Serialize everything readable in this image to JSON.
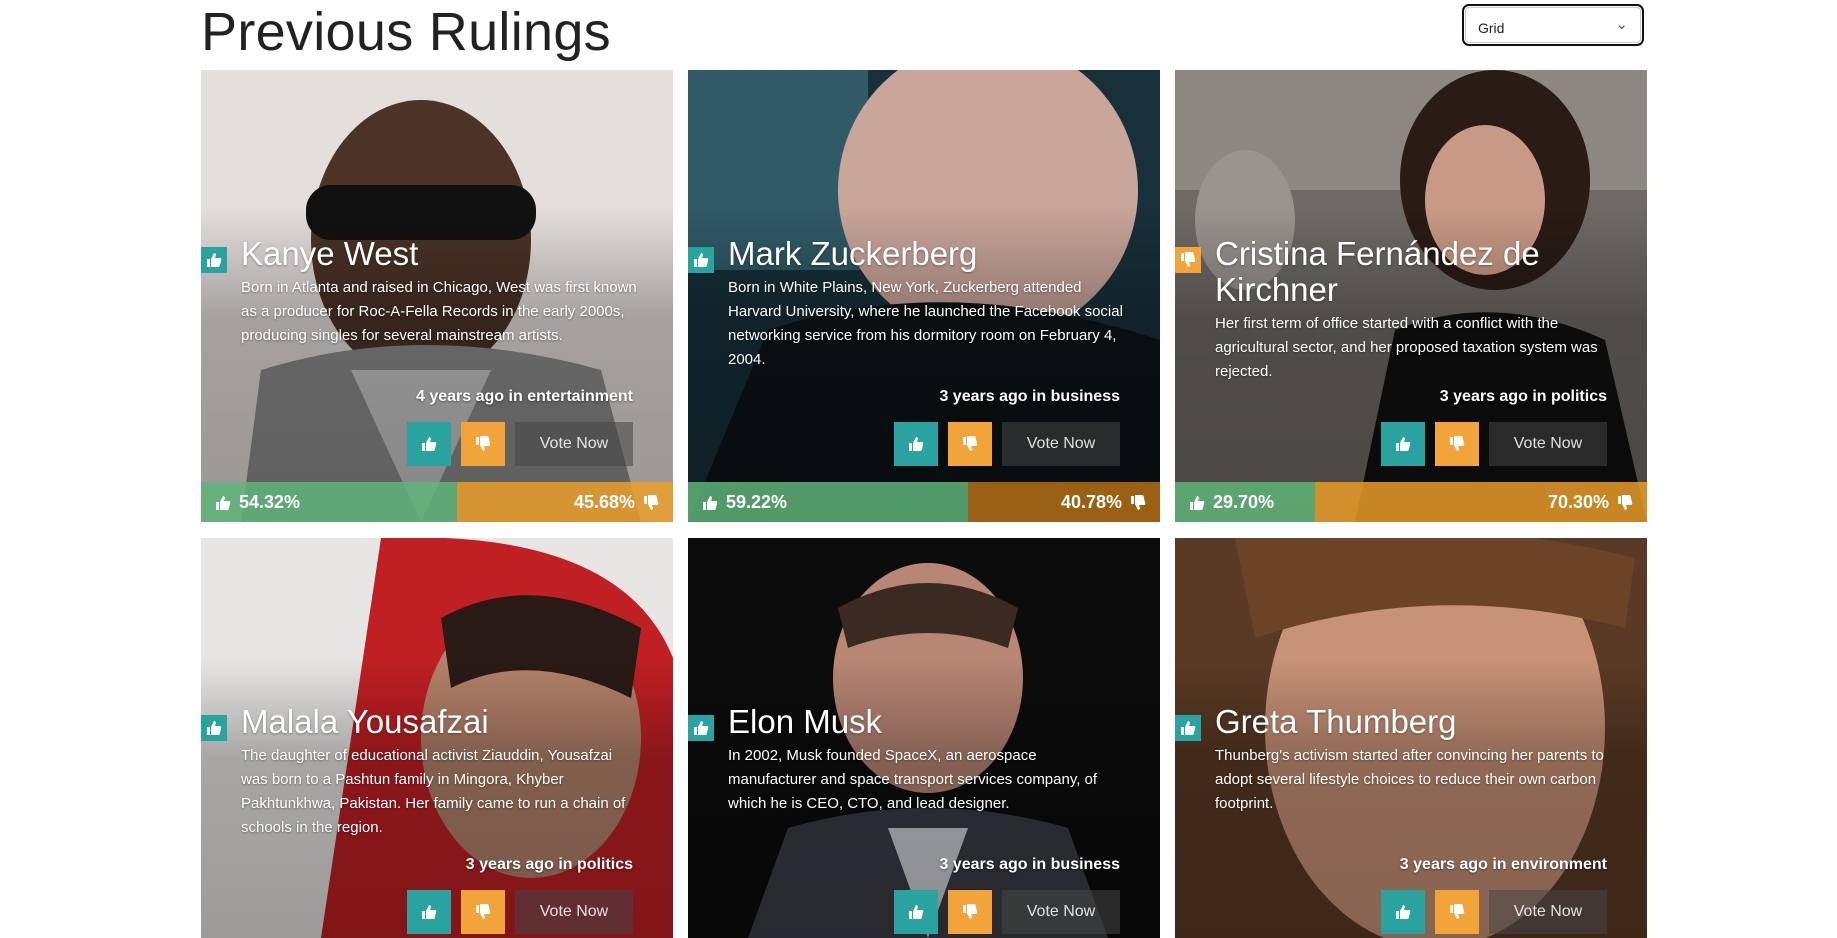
{
  "page": {
    "title": "Previous Rulings"
  },
  "view_select": {
    "value": "Grid",
    "icon": "chevron-down-icon"
  },
  "vote_label": "Vote Now",
  "colors": {
    "approve": "#2aa3a0",
    "reject": "#f2a43a",
    "approve_bar": "#5fb478",
    "reject_bar": "#f0a028"
  },
  "rulings": [
    {
      "name": "Kanye West",
      "description": "Born in Atlanta and raised in Chicago, West was first known as a producer for Roc-A-Fella Records in the early 2000s, producing singles for several mainstream artists.",
      "time": "4 years ago",
      "in_word": "in",
      "category": "entertainment",
      "trend": "up",
      "positive_pct": "54.32%",
      "negative_pct": "45.68%",
      "positive_value": 54.32
    },
    {
      "name": "Mark Zuckerberg",
      "description": "Born in White Plains, New York, Zuckerberg attended Harvard University, where he launched the Facebook social networking service from his dormitory room on February 4, 2004.",
      "time": "3 years ago",
      "in_word": "in",
      "category": "business",
      "trend": "up",
      "positive_pct": "59.22%",
      "negative_pct": "40.78%",
      "positive_value": 59.22
    },
    {
      "name": "Cristina Fernández de Kirchner",
      "description": "Her first term of office started with a conflict with the agricultural sector, and her proposed taxation system was rejected.",
      "time": "3 years ago",
      "in_word": "in",
      "category": "politics",
      "trend": "down",
      "positive_pct": "29.70%",
      "negative_pct": "70.30%",
      "positive_value": 29.7
    },
    {
      "name": "Malala Yousafzai",
      "description": "The daughter of educational activist Ziauddin, Yousafzai was born to a Pashtun family in Mingora, Khyber Pakhtunkhwa, Pakistan. Her family came to run a chain of schools in the region.",
      "time": "3 years ago",
      "in_word": "in",
      "category": "politics",
      "trend": "up"
    },
    {
      "name": "Elon Musk",
      "description": "In 2002, Musk founded SpaceX, an aerospace manufacturer and space transport services company, of which he is CEO, CTO, and lead designer.",
      "time": "3 years ago",
      "in_word": "in",
      "category": "business",
      "trend": "up"
    },
    {
      "name": "Greta Thumberg",
      "description": "Thunberg's activism started after convincing her parents to adopt several lifestyle choices to reduce their own carbon footprint.",
      "time": "3 years ago",
      "in_word": "in",
      "category": "environment",
      "trend": "up"
    }
  ]
}
